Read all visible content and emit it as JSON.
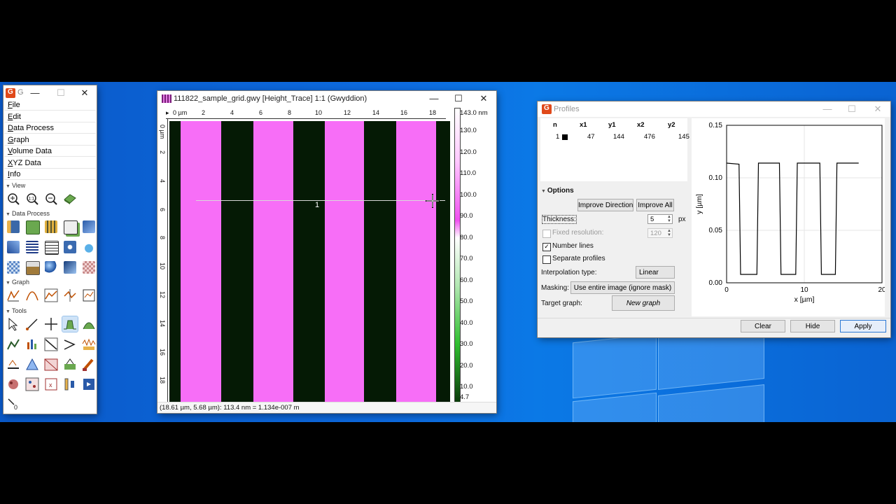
{
  "main_window": {
    "title": "G",
    "menu": [
      "File",
      "Edit",
      "Data Process",
      "Graph",
      "Volume Data",
      "XYZ Data",
      "Info"
    ],
    "sections": {
      "view": "View",
      "data_process": "Data Process",
      "graph": "Graph",
      "tools": "Tools"
    },
    "view_icons": [
      "zoom-in-icon",
      "zoom-1-1-icon",
      "zoom-out-icon",
      "3d-view-icon"
    ],
    "view_icon_1to1_text": "1:1"
  },
  "image_window": {
    "title": "111822_sample_grid.gwy [Height_Trace] 1:1 (Gwyddion)",
    "ruler_h": [
      "0 µm",
      "2",
      "4",
      "6",
      "8",
      "10",
      "12",
      "14",
      "16",
      "18"
    ],
    "ruler_v": [
      "0 µm",
      "2",
      "4",
      "6",
      "8",
      "10",
      "12",
      "14",
      "16",
      "18"
    ],
    "colorbar_labels": [
      "143.0 nm",
      "130.0",
      "120.0",
      "110.0",
      "100.0",
      "90.0",
      "80.0",
      "70.0",
      "60.0",
      "50.0",
      "40.0",
      "30.0",
      "20.0",
      "10.0",
      "4.7"
    ],
    "line_label": "1",
    "status": "(18.61 µm, 5.68 µm): 113.4 nm = 1.134e-007 m",
    "colors": {
      "pink": "#f76ef7",
      "dark": "#051a05"
    }
  },
  "profiles_window": {
    "title": "Profiles",
    "table": {
      "headers": [
        "n",
        "x1",
        "y1",
        "x2",
        "y2"
      ],
      "rows": [
        {
          "n": "1",
          "x1": "47",
          "y1": "144",
          "x2": "476",
          "y2": "145"
        }
      ]
    },
    "options_label": "Options",
    "improve_direction": "Improve Direction",
    "improve_all": "Improve All",
    "thickness_label": "Thickness:",
    "thickness_value": "5",
    "thickness_unit": "px",
    "fixed_resolution_label": "Fixed resolution:",
    "fixed_resolution_value": "120",
    "number_lines_label": "Number lines",
    "separate_profiles_label": "Separate profiles",
    "interpolation_label": "Interpolation type:",
    "interpolation_value": "Linear",
    "masking_label": "Masking:",
    "masking_value": "Use entire image (ignore mask)",
    "target_graph_label": "Target graph:",
    "target_graph_value": "New graph",
    "clear": "Clear",
    "hide": "Hide",
    "apply": "Apply",
    "checks": {
      "fixed_resolution": false,
      "number_lines": true,
      "separate_profiles": false
    }
  },
  "chart_data": {
    "type": "line",
    "xlabel": "x [µm]",
    "ylabel": "y [µm]",
    "xlim": [
      0,
      20
    ],
    "ylim": [
      0,
      0.15
    ],
    "xticks": [
      "0",
      "10",
      "20"
    ],
    "yticks": [
      "0.00",
      "0.05",
      "0.10",
      "0.15"
    ],
    "series": [
      {
        "x": [
          0,
          1.6,
          1.8,
          3.9,
          4.1,
          6.8,
          7.0,
          8.9,
          9.1,
          12.0,
          12.2,
          14.0,
          14.2,
          17.0
        ],
        "y": [
          0.114,
          0.113,
          0.008,
          0.008,
          0.114,
          0.114,
          0.008,
          0.008,
          0.114,
          0.114,
          0.008,
          0.008,
          0.114,
          0.114
        ]
      }
    ],
    "grid": true
  }
}
